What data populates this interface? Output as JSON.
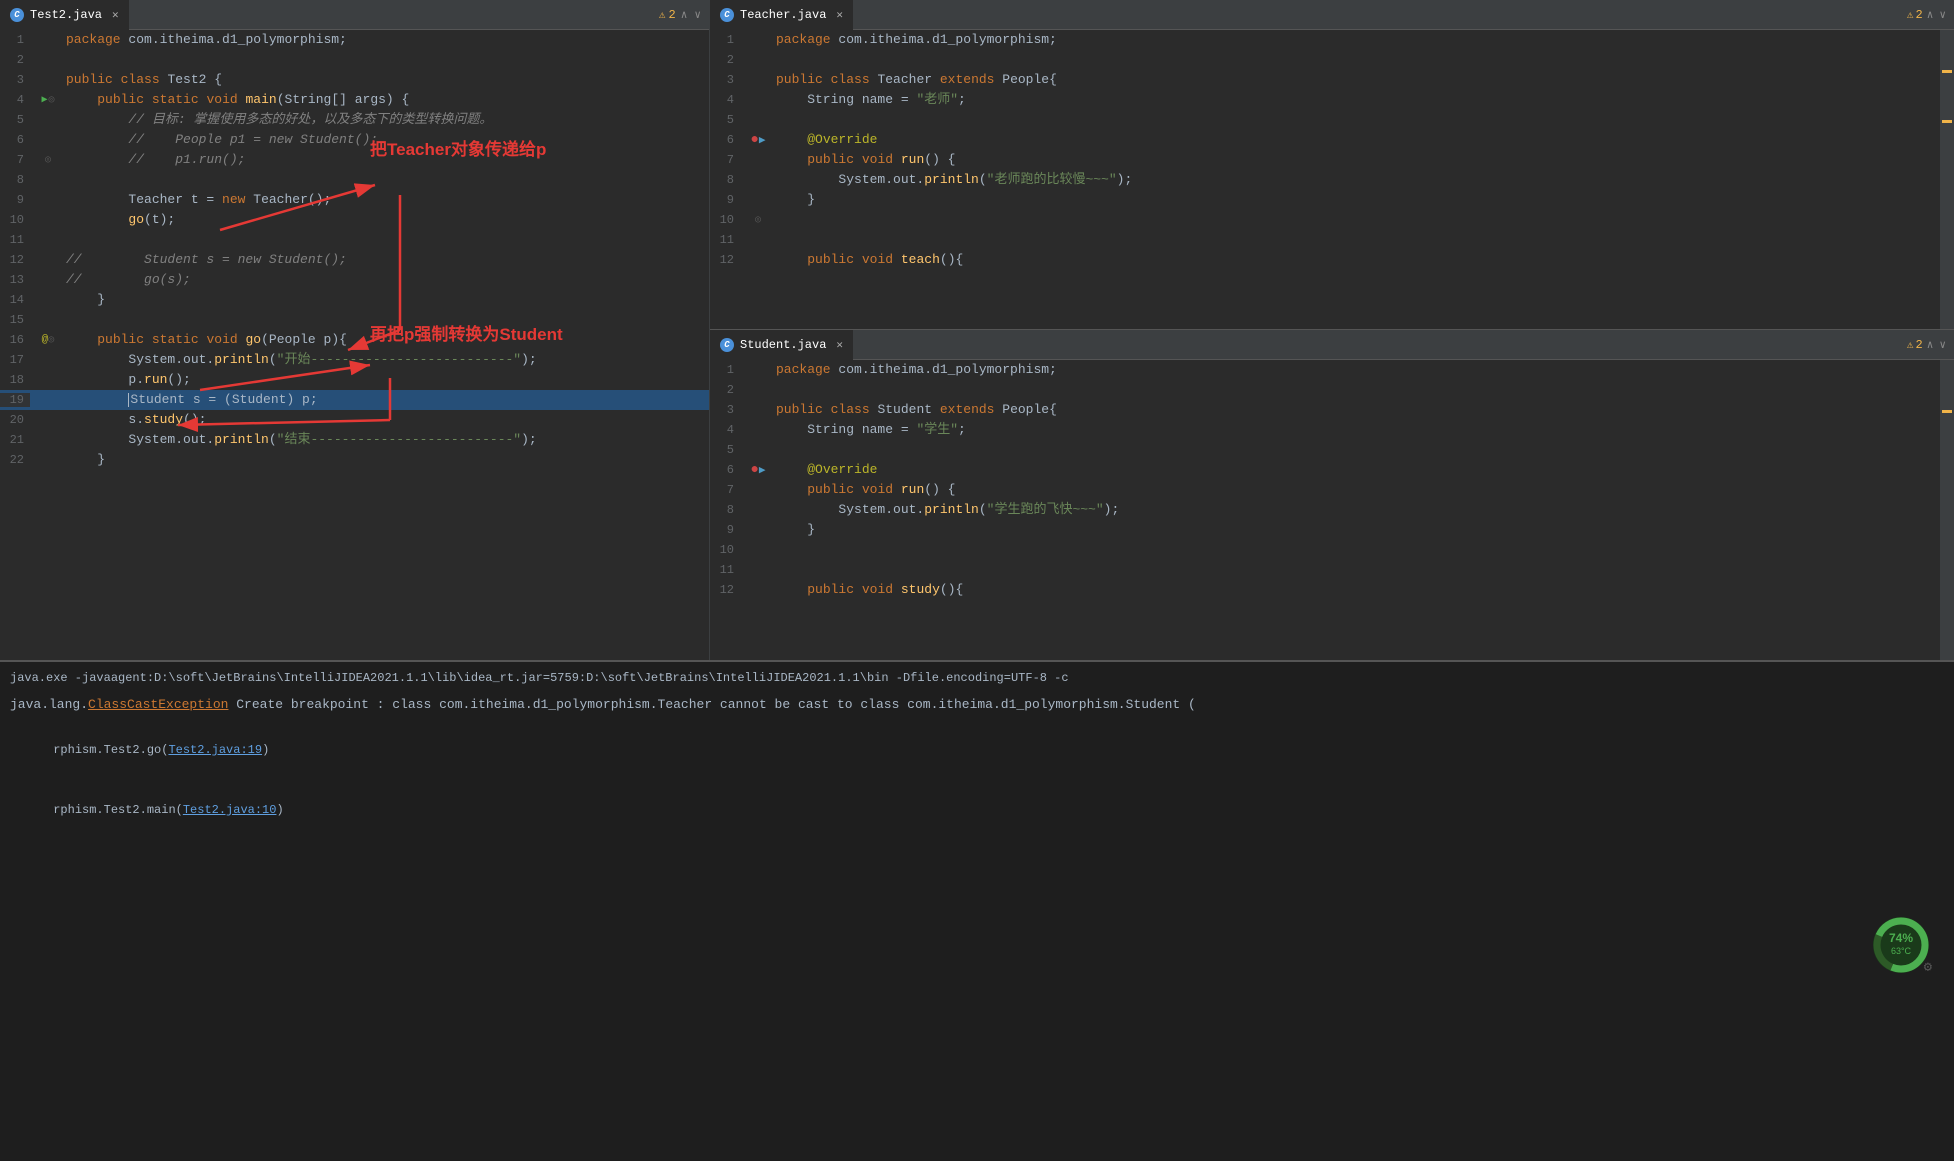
{
  "tabs": {
    "left": {
      "label": "Test2.java",
      "icon": "C"
    },
    "right_top": {
      "label": "Teacher.java",
      "icon": "C"
    },
    "right_bottom": {
      "label": "Student.java",
      "icon": "C"
    }
  },
  "warnings": {
    "count": "2"
  },
  "annotations": {
    "first": "把Teacher对象传递给p",
    "second": "再把p强制转换为Student"
  },
  "left_code": [
    {
      "ln": "1",
      "text": "package com.itheima.d1_polymorphism;"
    },
    {
      "ln": "2",
      "text": ""
    },
    {
      "ln": "3",
      "text": "public class Test2 {"
    },
    {
      "ln": "4",
      "text": "    public static void main(String[] args) {"
    },
    {
      "ln": "5",
      "text": "        // 目标: 掌握使用多态的好处，以及多态下的类型转换问题。"
    },
    {
      "ln": "6",
      "text": "        //    People p1 = new Student();"
    },
    {
      "ln": "7",
      "text": "        //    p1.run();"
    },
    {
      "ln": "8",
      "text": ""
    },
    {
      "ln": "9",
      "text": "        Teacher t = new Teacher();"
    },
    {
      "ln": "10",
      "text": "        go(t);"
    },
    {
      "ln": "11",
      "text": ""
    },
    {
      "ln": "12",
      "text": "//        Student s = new Student();"
    },
    {
      "ln": "13",
      "text": "//        go(s);"
    },
    {
      "ln": "14",
      "text": "    }"
    },
    {
      "ln": "15",
      "text": ""
    },
    {
      "ln": "16",
      "text": "    public static void go(People p){"
    },
    {
      "ln": "17",
      "text": "        System.out.println(\"开始--------------------------\");"
    },
    {
      "ln": "18",
      "text": "        p.run();"
    },
    {
      "ln": "19",
      "text": "        Student s = (Student) p;",
      "highlighted": true
    },
    {
      "ln": "20",
      "text": "        s.study();"
    },
    {
      "ln": "21",
      "text": "        System.out.println(\"结束--------------------------\");"
    },
    {
      "ln": "22",
      "text": "    }"
    }
  ],
  "right_top_code": [
    {
      "ln": "1",
      "text": "package com.itheima.d1_polymorphism;"
    },
    {
      "ln": "2",
      "text": ""
    },
    {
      "ln": "3",
      "text": "public class Teacher extends People{"
    },
    {
      "ln": "4",
      "text": "    String name = \"老师\";"
    },
    {
      "ln": "5",
      "text": ""
    },
    {
      "ln": "6",
      "text": "    @Override",
      "breakpoint": true,
      "debugarrow": true
    },
    {
      "ln": "7",
      "text": "    public void run() {"
    },
    {
      "ln": "8",
      "text": "        System.out.println(\"老师跑的比较慢~~~\");"
    },
    {
      "ln": "9",
      "text": "    }"
    },
    {
      "ln": "10",
      "text": ""
    },
    {
      "ln": "11",
      "text": ""
    },
    {
      "ln": "12",
      "text": "    public void teach(){"
    }
  ],
  "right_bottom_code": [
    {
      "ln": "1",
      "text": "package com.itheima.d1_polymorphism;"
    },
    {
      "ln": "2",
      "text": ""
    },
    {
      "ln": "3",
      "text": "public class Student extends People{"
    },
    {
      "ln": "4",
      "text": "    String name = \"学生\";"
    },
    {
      "ln": "5",
      "text": ""
    },
    {
      "ln": "6",
      "text": "    @Override",
      "breakpoint": true,
      "debugarrow": true
    },
    {
      "ln": "7",
      "text": "    public void run() {"
    },
    {
      "ln": "8",
      "text": "        System.out.println(\"学生跑的飞快~~~\");"
    },
    {
      "ln": "9",
      "text": "    }"
    },
    {
      "ln": "10",
      "text": ""
    },
    {
      "ln": "11",
      "text": ""
    },
    {
      "ln": "12",
      "text": "    public void study(){"
    }
  ],
  "console": {
    "cmd": "java.exe -javaagent:D:\\soft\\JetBrains\\IntelliJIDEA2021.1.1\\lib\\idea_rt.jar=5759:D:\\soft\\JetBrains\\IntelliJIDEA2021.1.1\\bin -Dfile.encoding=UTF-8 -c",
    "error_line": "java.lang.ClassCastException Create breakpoint : class com.itheima.d1_polymorphism.Teacher cannot be cast to class com.itheima.d1_polymorphism.Student (",
    "stack1": "rphism.Test2.go(Test2.java:19)",
    "stack2": "rphism.Test2.main(Test2.java:10)",
    "link1": "Test2.java:19",
    "link2": "Test2.java:10"
  },
  "cpu": {
    "percent": "74%",
    "temp": "63°C"
  }
}
